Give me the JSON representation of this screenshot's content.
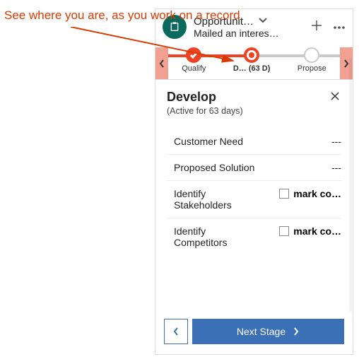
{
  "annotation": "See where you are, as you work on a record",
  "header": {
    "title": "Opportunit…",
    "subtitle": "Mailed an interes…"
  },
  "progress": {
    "stages": [
      {
        "label": "Qualify",
        "state": "done"
      },
      {
        "label": "D…   (63 D)",
        "state": "active"
      },
      {
        "label": "Propose",
        "state": "future"
      }
    ]
  },
  "stage": {
    "title": "Develop",
    "subtitle": "(Active for 63 days)",
    "fields": [
      {
        "label": "Customer Need",
        "value": "---",
        "type": "text"
      },
      {
        "label": "Proposed Solution",
        "value": "---",
        "type": "text"
      },
      {
        "label": "Identify Stakeholders",
        "value": "mark co…",
        "type": "check"
      },
      {
        "label": "Identify Competitors",
        "value": "mark co…",
        "type": "check"
      }
    ]
  },
  "footer": {
    "next_label": "Next Stage"
  }
}
